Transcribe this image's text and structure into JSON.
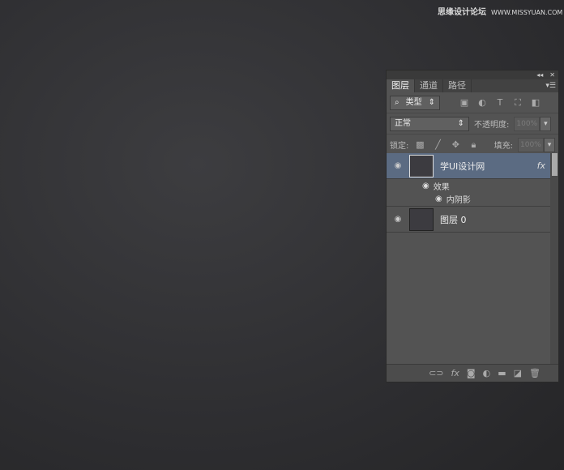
{
  "watermark": {
    "cn": "思缘设计论坛",
    "url": "WWW.MISSYUAN.COM"
  },
  "panel": {
    "collapse": "◂◂",
    "close": "✕",
    "tabs": [
      "图层",
      "通道",
      "路径"
    ],
    "menu": "▾☰",
    "filter": "类型",
    "blend": "正常",
    "opacity_label": "不透明度:",
    "opacity": "100%",
    "lock_label": "锁定:",
    "fill_label": "填充:",
    "fill": "100%",
    "layers": [
      {
        "name": "学UI设计网",
        "fx": "fx",
        "effects_label": "效果",
        "effect": "内阴影"
      },
      {
        "name": "图层 0"
      }
    ]
  }
}
